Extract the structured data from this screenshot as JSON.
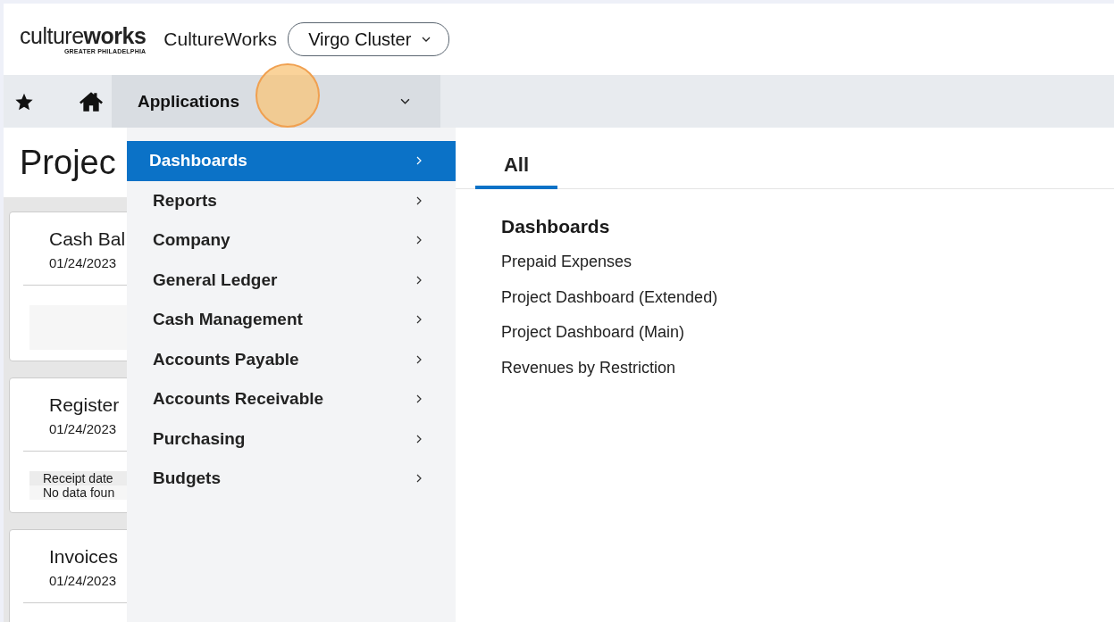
{
  "header": {
    "logo": {
      "wordmark": "culture**works**",
      "tagline": "GREATER PHILADELPHIA"
    },
    "company": "CultureWorks",
    "entity_selector": {
      "value": "Virgo Cluster"
    }
  },
  "nav": {
    "menu_label": "Applications"
  },
  "page": {
    "title": "Projec",
    "cards": [
      {
        "title": "Cash Bal",
        "date": "01/24/2023",
        "kind": "blank"
      },
      {
        "title": "Register",
        "date": "01/24/2023",
        "kind": "table",
        "column": "Receipt date",
        "empty_text": "No data foun"
      },
      {
        "title": "Invoices",
        "date": "01/24/2023"
      }
    ]
  },
  "menu": {
    "items": [
      {
        "label": "Dashboards",
        "selected": true
      },
      {
        "label": "Reports",
        "selected": false
      },
      {
        "label": "Company",
        "selected": false
      },
      {
        "label": "General Ledger",
        "selected": false
      },
      {
        "label": "Cash Management",
        "selected": false
      },
      {
        "label": "Accounts Payable",
        "selected": false
      },
      {
        "label": "Accounts Receivable",
        "selected": false
      },
      {
        "label": "Purchasing",
        "selected": false
      },
      {
        "label": "Budgets",
        "selected": false
      }
    ]
  },
  "panel": {
    "tabs": [
      {
        "label": "All",
        "selected": true
      }
    ],
    "section": "Dashboards",
    "links": [
      "Prepaid Expenses",
      "Project Dashboard (Extended)",
      "Project Dashboard (Main)",
      "Revenues by Restriction"
    ]
  }
}
